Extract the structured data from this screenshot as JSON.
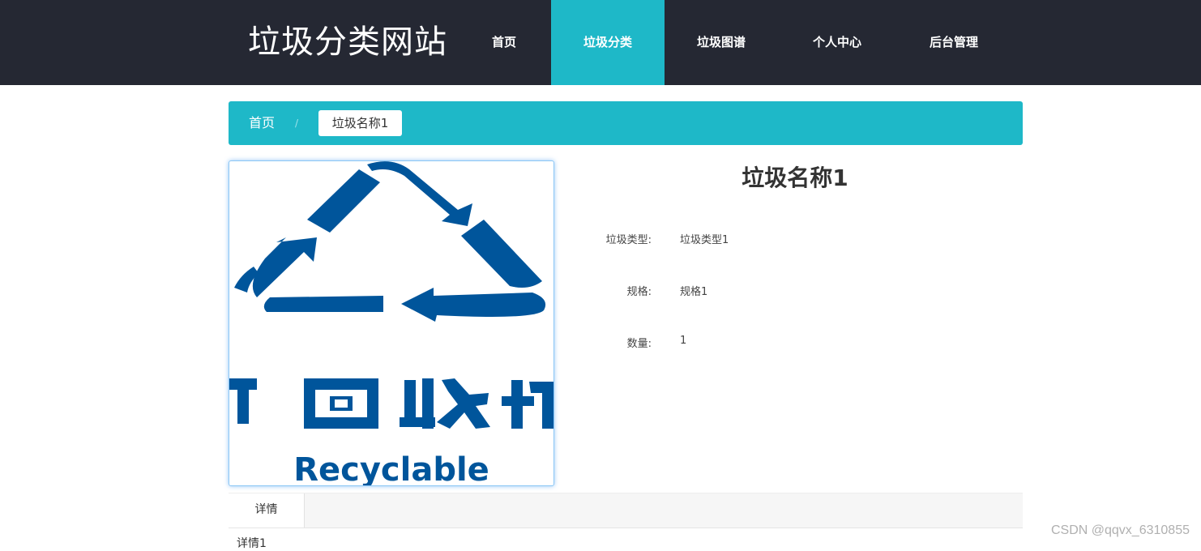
{
  "header": {
    "site_title": "垃圾分类网站",
    "nav": [
      {
        "label": "首页",
        "active": false
      },
      {
        "label": "垃圾分类",
        "active": true
      },
      {
        "label": "垃圾图谱",
        "active": false
      },
      {
        "label": "个人中心",
        "active": false
      },
      {
        "label": "后台管理",
        "active": false
      }
    ]
  },
  "breadcrumb": {
    "home": "首页",
    "separator": "/",
    "current": "垃圾名称1"
  },
  "item": {
    "title": "垃圾名称1",
    "image": {
      "chinese_text": "可回收物",
      "english_text": "Recyclable",
      "color": "#00559b"
    },
    "fields": [
      {
        "label": "垃圾类型:",
        "value": "垃圾类型1"
      },
      {
        "label": "规格:",
        "value": "规格1"
      },
      {
        "label": "数量:",
        "value": "1"
      }
    ]
  },
  "tabs": [
    {
      "label": "详情",
      "active": true
    }
  ],
  "detail": {
    "text": "详情1"
  },
  "watermark": "CSDN @qqvx_6310855",
  "colors": {
    "header_bg": "#252833",
    "accent": "#1eb8c8"
  }
}
